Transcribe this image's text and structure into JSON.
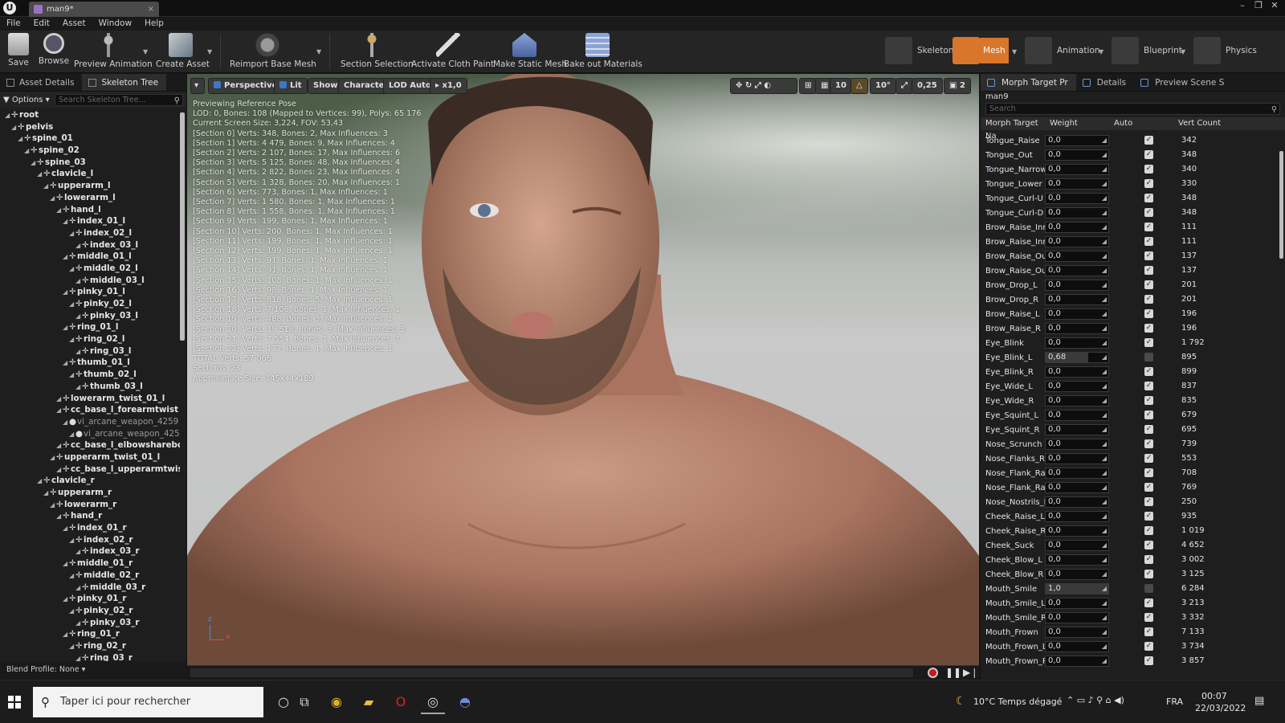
{
  "window": {
    "tab_title": "man9*",
    "app_logo": "U"
  },
  "menu": [
    "File",
    "Edit",
    "Asset",
    "Window",
    "Help"
  ],
  "toolbar": {
    "buttons": [
      {
        "label": "Save",
        "icon": "save-icon"
      },
      {
        "label": "Browse",
        "icon": "browse-icon"
      },
      {
        "label": "Preview Animation",
        "icon": "preview-animation-icon"
      },
      {
        "label": "Create Asset",
        "icon": "create-asset-icon"
      },
      {
        "label": "Reimport Base Mesh",
        "icon": "reimport-icon"
      },
      {
        "label": "Section Selection",
        "icon": "section-selection-icon"
      },
      {
        "label": "Activate Cloth Paint",
        "icon": "cloth-paint-icon"
      },
      {
        "label": "Make Static Mesh",
        "icon": "static-mesh-icon"
      },
      {
        "label": "Bake out Materials",
        "icon": "bake-materials-icon"
      }
    ],
    "modes": [
      {
        "label": "Skeleton",
        "active": false
      },
      {
        "label": "Mesh",
        "active": true
      },
      {
        "label": "Animation",
        "active": false
      },
      {
        "label": "Blueprint",
        "active": false
      },
      {
        "label": "Physics",
        "active": false
      }
    ]
  },
  "left_panel": {
    "tabs": [
      "Asset Details",
      "Skeleton Tree"
    ],
    "options_label": "Options",
    "search_placeholder": "Search Skeleton Tree...",
    "blend_profile": "Blend Profile: None",
    "tree": [
      {
        "name": "root",
        "depth": 0
      },
      {
        "name": "pelvis",
        "depth": 1
      },
      {
        "name": "spine_01",
        "depth": 2
      },
      {
        "name": "spine_02",
        "depth": 3
      },
      {
        "name": "spine_03",
        "depth": 4
      },
      {
        "name": "clavicle_l",
        "depth": 5
      },
      {
        "name": "upperarm_l",
        "depth": 6
      },
      {
        "name": "lowerarm_l",
        "depth": 7
      },
      {
        "name": "hand_l",
        "depth": 8
      },
      {
        "name": "index_01_l",
        "depth": 9
      },
      {
        "name": "index_02_l",
        "depth": 10
      },
      {
        "name": "index_03_l",
        "depth": 11
      },
      {
        "name": "middle_01_l",
        "depth": 9
      },
      {
        "name": "middle_02_l",
        "depth": 10
      },
      {
        "name": "middle_03_l",
        "depth": 11
      },
      {
        "name": "pinky_01_l",
        "depth": 9
      },
      {
        "name": "pinky_02_l",
        "depth": 10
      },
      {
        "name": "pinky_03_l",
        "depth": 11
      },
      {
        "name": "ring_01_l",
        "depth": 9
      },
      {
        "name": "ring_02_l",
        "depth": 10
      },
      {
        "name": "ring_03_l",
        "depth": 11
      },
      {
        "name": "thumb_01_l",
        "depth": 9
      },
      {
        "name": "thumb_02_l",
        "depth": 10
      },
      {
        "name": "thumb_03_l",
        "depth": 11
      },
      {
        "name": "lowerarm_twist_01_l",
        "depth": 8
      },
      {
        "name": "cc_base_l_forearmtwist",
        "depth": 8
      },
      {
        "name": "vi_arcane_weapon_4259",
        "depth": 9,
        "dim": true
      },
      {
        "name": "vi_arcane_weapon_425",
        "depth": 10,
        "dim": true
      },
      {
        "name": "cc_base_l_elbowsharebo",
        "depth": 8
      },
      {
        "name": "upperarm_twist_01_l",
        "depth": 7
      },
      {
        "name": "cc_base_l_upperarmtwis",
        "depth": 8
      },
      {
        "name": "clavicle_r",
        "depth": 5
      },
      {
        "name": "upperarm_r",
        "depth": 6
      },
      {
        "name": "lowerarm_r",
        "depth": 7
      },
      {
        "name": "hand_r",
        "depth": 8
      },
      {
        "name": "index_01_r",
        "depth": 9
      },
      {
        "name": "index_02_r",
        "depth": 10
      },
      {
        "name": "index_03_r",
        "depth": 11
      },
      {
        "name": "middle_01_r",
        "depth": 9
      },
      {
        "name": "middle_02_r",
        "depth": 10
      },
      {
        "name": "middle_03_r",
        "depth": 11
      },
      {
        "name": "pinky_01_r",
        "depth": 9
      },
      {
        "name": "pinky_02_r",
        "depth": 10
      },
      {
        "name": "pinky_03_r",
        "depth": 11
      },
      {
        "name": "ring_01_r",
        "depth": 9
      },
      {
        "name": "ring_02_r",
        "depth": 10
      },
      {
        "name": "ring_03_r",
        "depth": 11
      }
    ]
  },
  "viewport": {
    "buttons": {
      "perspective": "Perspective",
      "lit": "Lit",
      "show": "Show",
      "character": "Character",
      "lod": "LOD Auto",
      "speed": "x1,0",
      "grid": "10",
      "angle": "10°",
      "scale": "0,25",
      "camspeed": "2"
    },
    "stats": [
      "Previewing Reference Pose",
      "LOD: 0, Bones: 108 (Mapped to Vertices: 99), Polys: 65 176",
      "Current Screen Size: 3,224, FOV: 53,43",
      "[Section 0] Verts: 348, Bones: 2, Max Influences: 3",
      "[Section 1] Verts: 4 479, Bones: 9, Max Influences: 4",
      "[Section 2] Verts: 2 107, Bones: 17, Max Influences: 6",
      "[Section 3] Verts: 5 125, Bones: 48, Max Influences: 4",
      "[Section 4] Verts: 2 822, Bones: 23, Max Influences: 4",
      "[Section 5] Verts: 1 328, Bones: 20, Max Influences: 1",
      "[Section 6] Verts: 773, Bones: 1, Max Influences: 1",
      "[Section 7] Verts: 1 580, Bones: 1, Max Influences: 1",
      "[Section 8] Verts: 1 558, Bones: 1, Max Influences: 1",
      "[Section 9] Verts: 199, Bones: 1, Max Influences: 1",
      "[Section 10] Verts: 200, Bones: 1, Max Influences: 1",
      "[Section 11] Verts: 199, Bones: 1, Max Influences: 1",
      "[Section 12] Verts: 199, Bones: 1, Max Influences: 1",
      "[Section 13] Verts: 91, Bones: 1, Max Influences: 1",
      "[Section 14] Verts: 91, Bones: 1, Max Influences: 1",
      "[Section 15] Verts: 108, Bones: 1, Max Influences: 1",
      "[Section 16] Verts: 98, Bones: 1, Max Influences: 1",
      "[Section 17] Verts: 818, Bones: 5, Max Influences: 1",
      "[Section 18] Verts: 7 106, Bones: 1, Max Influences: 1",
      "[Section 19] Verts: 488, Bones: 3, Max Influences: 1",
      "[Section 20] Verts: 19 518, Bones: 3, Max Influences: 3",
      "[Section 21] Verts: 7 554, Bones: 1, Max Influences: 1",
      "[Section 22] Verts: 177, Bones: 1, Max Influences: 1",
      "TOTAL Verts: 57 066",
      "Sections: 23",
      "Approximate Size: 145x44x189"
    ],
    "axis": {
      "z": "z",
      "x": "x"
    }
  },
  "right_panel": {
    "tabs": [
      "Morph Target Pr",
      "Details",
      "Preview Scene S"
    ],
    "asset_name": "man9",
    "search_placeholder": "Search",
    "columns": [
      "Morph Target Na",
      "Weight",
      "Auto",
      "Vert Count"
    ],
    "morphs": [
      {
        "name": "Tongue_Raise",
        "weight": "0,0",
        "auto": true,
        "verts": "342"
      },
      {
        "name": "Tongue_Out",
        "weight": "0,0",
        "auto": true,
        "verts": "348"
      },
      {
        "name": "Tongue_Narrow",
        "weight": "0,0",
        "auto": true,
        "verts": "340"
      },
      {
        "name": "Tongue_Lower",
        "weight": "0,0",
        "auto": true,
        "verts": "330"
      },
      {
        "name": "Tongue_Curl-U",
        "weight": "0,0",
        "auto": true,
        "verts": "348"
      },
      {
        "name": "Tongue_Curl-D",
        "weight": "0,0",
        "auto": true,
        "verts": "348"
      },
      {
        "name": "Brow_Raise_Inner",
        "weight": "0,0",
        "auto": true,
        "verts": "111"
      },
      {
        "name": "Brow_Raise_Inner",
        "weight": "0,0",
        "auto": true,
        "verts": "111"
      },
      {
        "name": "Brow_Raise_Outer",
        "weight": "0,0",
        "auto": true,
        "verts": "137"
      },
      {
        "name": "Brow_Raise_Outer",
        "weight": "0,0",
        "auto": true,
        "verts": "137"
      },
      {
        "name": "Brow_Drop_L",
        "weight": "0,0",
        "auto": true,
        "verts": "201"
      },
      {
        "name": "Brow_Drop_R",
        "weight": "0,0",
        "auto": true,
        "verts": "201"
      },
      {
        "name": "Brow_Raise_L",
        "weight": "0,0",
        "auto": true,
        "verts": "196"
      },
      {
        "name": "Brow_Raise_R",
        "weight": "0,0",
        "auto": true,
        "verts": "196"
      },
      {
        "name": "Eye_Blink",
        "weight": "0,0",
        "auto": true,
        "verts": "1 792"
      },
      {
        "name": "Eye_Blink_L",
        "weight": "0,68",
        "fill": 0.68,
        "auto": false,
        "verts": "895"
      },
      {
        "name": "Eye_Blink_R",
        "weight": "0,0",
        "auto": true,
        "verts": "899"
      },
      {
        "name": "Eye_Wide_L",
        "weight": "0,0",
        "auto": true,
        "verts": "837"
      },
      {
        "name": "Eye_Wide_R",
        "weight": "0,0",
        "auto": true,
        "verts": "835"
      },
      {
        "name": "Eye_Squint_L",
        "weight": "0,0",
        "auto": true,
        "verts": "679"
      },
      {
        "name": "Eye_Squint_R",
        "weight": "0,0",
        "auto": true,
        "verts": "695"
      },
      {
        "name": "Nose_Scrunch",
        "weight": "0,0",
        "auto": true,
        "verts": "739"
      },
      {
        "name": "Nose_Flanks_Rais",
        "weight": "0,0",
        "auto": true,
        "verts": "553"
      },
      {
        "name": "Nose_Flank_Raise",
        "weight": "0,0",
        "auto": true,
        "verts": "708"
      },
      {
        "name": "Nose_Flank_Raise",
        "weight": "0,0",
        "auto": true,
        "verts": "769"
      },
      {
        "name": "Nose_Nostrils_Fla",
        "weight": "0,0",
        "auto": true,
        "verts": "250"
      },
      {
        "name": "Cheek_Raise_L",
        "weight": "0,0",
        "auto": true,
        "verts": "935"
      },
      {
        "name": "Cheek_Raise_R",
        "weight": "0,0",
        "auto": true,
        "verts": "1 019"
      },
      {
        "name": "Cheek_Suck",
        "weight": "0,0",
        "auto": true,
        "verts": "4 652"
      },
      {
        "name": "Cheek_Blow_L",
        "weight": "0,0",
        "auto": true,
        "verts": "3 002"
      },
      {
        "name": "Cheek_Blow_R",
        "weight": "0,0",
        "auto": true,
        "verts": "3 125"
      },
      {
        "name": "Mouth_Smile",
        "weight": "1,0",
        "fill": 1.0,
        "auto": false,
        "verts": "6 284"
      },
      {
        "name": "Mouth_Smile_L",
        "weight": "0,0",
        "auto": true,
        "verts": "3 213"
      },
      {
        "name": "Mouth_Smile_R",
        "weight": "0,0",
        "auto": true,
        "verts": "3 332"
      },
      {
        "name": "Mouth_Frown",
        "weight": "0,0",
        "auto": true,
        "verts": "7 133"
      },
      {
        "name": "Mouth_Frown_L",
        "weight": "0,0",
        "auto": true,
        "verts": "3 734"
      },
      {
        "name": "Mouth_Frown_R",
        "weight": "0,0",
        "auto": true,
        "verts": "3 857"
      }
    ]
  },
  "taskbar": {
    "search_placeholder": "Taper ici pour rechercher",
    "weather": "10°C  Temps dégagé",
    "language": "FRA",
    "time": "00:07",
    "date": "22/03/2022"
  }
}
